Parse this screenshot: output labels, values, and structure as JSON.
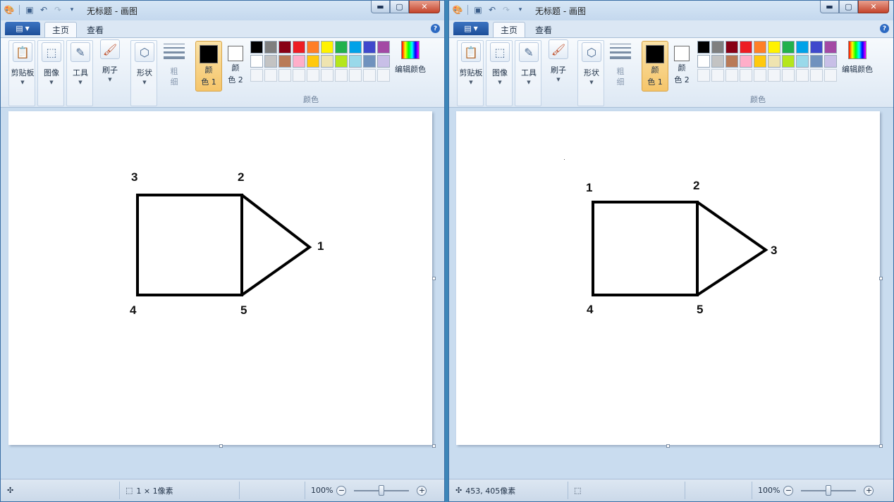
{
  "windows": [
    {
      "title": "无标题 - 画图",
      "tabs": [
        "主页",
        "查看"
      ],
      "ribbon": {
        "clipboard": "剪贴板",
        "image": "图像",
        "tools": "工具",
        "brushes": "刷子",
        "shapes": "形状",
        "thickness_a": "粗",
        "thickness_b": "细",
        "color1_a": "颜",
        "color1_b": "色 1",
        "color2_a": "颜",
        "color2_b": "色 2",
        "edit_colors": "编辑颜色",
        "colors_group": "颜色"
      },
      "shape_labels": [
        "3",
        "2",
        "1",
        "4",
        "5"
      ],
      "status": {
        "position": "",
        "selection": "1 × 1像素",
        "zoom": "100%"
      }
    },
    {
      "title": "无标题 - 画图",
      "tabs": [
        "主页",
        "查看"
      ],
      "ribbon": {
        "clipboard": "剪贴板",
        "image": "图像",
        "tools": "工具",
        "brushes": "刷子",
        "shapes": "形状",
        "thickness_a": "粗",
        "thickness_b": "细",
        "color1_a": "颜",
        "color1_b": "色 1",
        "color2_a": "颜",
        "color2_b": "色 2",
        "edit_colors": "编辑颜色",
        "colors_group": "颜色"
      },
      "shape_labels": [
        "1",
        "2",
        "3",
        "4",
        "5"
      ],
      "status": {
        "position": "453, 405像素",
        "selection": "",
        "zoom": "100%"
      }
    }
  ],
  "palette": {
    "row1": [
      "#000000",
      "#7f7f7f",
      "#880015",
      "#ed1c24",
      "#ff7f27",
      "#fff200",
      "#22b14c",
      "#00a2e8",
      "#3f48cc",
      "#a349a4"
    ],
    "row2": [
      "#ffffff",
      "#c3c3c3",
      "#b97a57",
      "#ffaec9",
      "#ffc90e",
      "#efe4b0",
      "#b5e61d",
      "#99d9ea",
      "#7092be",
      "#c8bfe7"
    ],
    "color1": "#000000",
    "color2": "#ffffff"
  },
  "icons": {
    "clipboard": "clipboard-icon",
    "image": "select-icon",
    "tools": "tools-icon",
    "brushes": "brush-icon",
    "shapes": "shapes-icon",
    "zoom_out": "zoom-out-icon",
    "zoom_in": "zoom-in-icon"
  }
}
